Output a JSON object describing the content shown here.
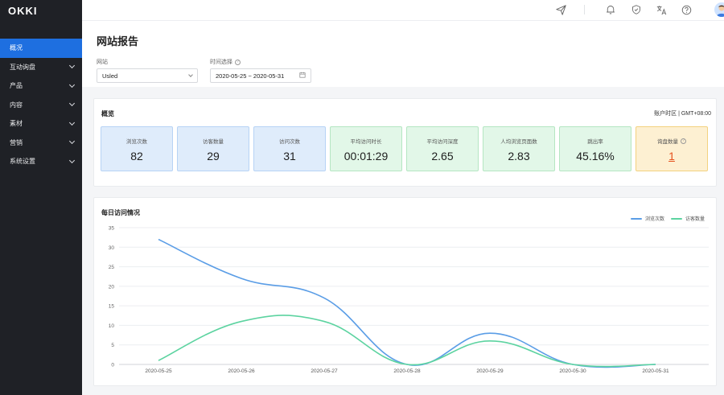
{
  "app": {
    "logo": "OKKI"
  },
  "sidebar": {
    "items": [
      {
        "label": "概况",
        "active": true,
        "has_children": false
      },
      {
        "label": "互动询盘",
        "active": false,
        "has_children": true
      },
      {
        "label": "产品",
        "active": false,
        "has_children": true
      },
      {
        "label": "内容",
        "active": false,
        "has_children": true
      },
      {
        "label": "素材",
        "active": false,
        "has_children": true
      },
      {
        "label": "营销",
        "active": false,
        "has_children": true
      },
      {
        "label": "系统设置",
        "active": false,
        "has_children": true
      }
    ]
  },
  "topbar": {
    "icons": [
      "send-icon",
      "bell-icon",
      "shield-icon",
      "translate-icon",
      "help-icon",
      "avatar"
    ]
  },
  "header": {
    "title": "网站报告",
    "site_label": "网站",
    "site_value": "Usled",
    "time_label": "时间选择",
    "date_range": "2020-05-25 ~ 2020-05-31"
  },
  "overview": {
    "title": "概览",
    "timezone": "账户时区 | GMT+08:00",
    "kpis": [
      {
        "label": "浏览次数",
        "value": "82",
        "style": "blue"
      },
      {
        "label": "访客数量",
        "value": "29",
        "style": "blue"
      },
      {
        "label": "访问次数",
        "value": "31",
        "style": "blue"
      },
      {
        "label": "平均访问时长",
        "value": "00:01:29",
        "style": "green"
      },
      {
        "label": "平均访问深度",
        "value": "2.65",
        "style": "green"
      },
      {
        "label": "人均浏览页面数",
        "value": "2.83",
        "style": "green"
      },
      {
        "label": "跳出率",
        "value": "45.16%",
        "style": "green"
      },
      {
        "label": "询盘数量",
        "value": "1",
        "style": "orange",
        "help": true
      }
    ]
  },
  "colors": {
    "accent": "#1e6fe0",
    "series_views": "#5a9de6",
    "series_visitors": "#5cd3a0"
  },
  "chart_data": {
    "type": "line",
    "title": "每日访问情况",
    "x": [
      "2020-05-25",
      "2020-05-26",
      "2020-05-27",
      "2020-05-28",
      "2020-05-29",
      "2020-05-30",
      "2020-05-31"
    ],
    "series": [
      {
        "name": "浏览次数",
        "values": [
          32,
          22,
          17,
          0,
          8,
          0,
          0
        ]
      },
      {
        "name": "访客数量",
        "values": [
          1,
          11,
          11,
          0,
          6,
          0,
          0
        ]
      }
    ],
    "ylim": [
      0,
      35
    ],
    "yticks": [
      0,
      5,
      10,
      15,
      20,
      25,
      30,
      35
    ],
    "grid": true,
    "legend": "top-right"
  }
}
